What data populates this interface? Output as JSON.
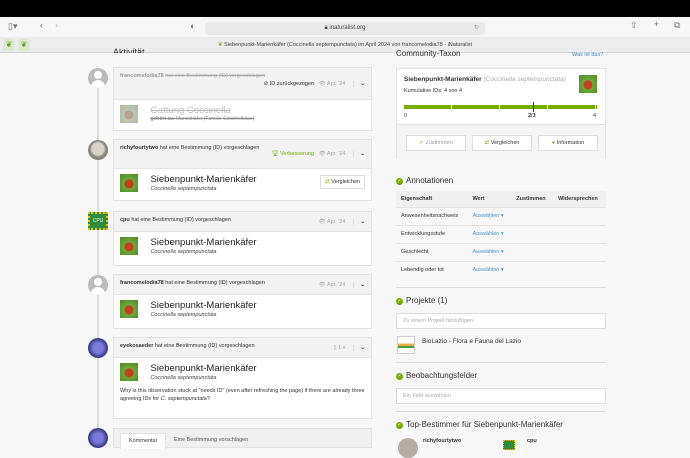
{
  "browser": {
    "url": "inaturalist.org",
    "tab_title": "Siebenpunkt-Marienkäfer (Coccinella septempunctata) im April 2024 von francomelodia78 · iNaturalist"
  },
  "activity": {
    "heading": "Aktivität",
    "items": [
      {
        "user": "francomelodia78",
        "action": "hat eine Bestimmung (ID) vorgeschlagen",
        "status": "ID zurückgezogen",
        "date": "Apr. '24",
        "taxon_common": "Gattung Coccinella",
        "belongs_label": "gehört zu:",
        "belongs": "Marienkäfer (Familie Coccinellidae)"
      },
      {
        "user": "richyfourtytwo",
        "action": "hat eine Bestimmung (ID) vorgeschlagen",
        "status": "Verbesserung",
        "date": "Apr. '24",
        "taxon_common": "Siebenpunkt-Marienkäfer",
        "taxon_sci": "Coccinella septempunctata",
        "compare": "Vergleichen"
      },
      {
        "user": "cpu",
        "action": "hat eine Bestimmung (ID) vorgeschlagen",
        "date": "Apr. '24",
        "taxon_common": "Siebenpunkt-Marienkäfer",
        "taxon_sci": "Coccinella septempunctata"
      },
      {
        "user": "francomelodia78",
        "action": "hat eine Bestimmung (ID) vorgeschlagen",
        "date": "Apr. '24",
        "taxon_common": "Siebenpunkt-Marienkäfer",
        "taxon_sci": "Coccinella septempunctata"
      },
      {
        "user": "eyekosaeder",
        "action": "hat eine Bestimmung (ID) vorgeschlagen",
        "date": "1 s",
        "taxon_common": "Siebenpunkt-Marienkäfer",
        "taxon_sci": "Coccinella septempunctata",
        "comment": "Why is this observation stuck at \"needs ID\" (even after refreshing the page) if there are already three agreeing IDs for",
        "comment_taxon": "C. septempunctata",
        "comment_end": "?"
      }
    ],
    "tabs": [
      "Kommentar",
      "Eine Bestimmung vorschlagen"
    ]
  },
  "community": {
    "title": "Community-Taxon",
    "help": "Was ist das?",
    "common": "Siebenpunkt-Marienkäfer",
    "sci": "(Coccinella septempunctata)",
    "cumulative": "Kumulative IDs: 4 von 4",
    "progress": 1.0,
    "scale_min": "0",
    "scale_mid": "2/3",
    "scale_max": "4",
    "agree": "Zustimmen",
    "compare": "Vergleichen",
    "info": "Information"
  },
  "annotations": {
    "title": "Annotationen",
    "headers": [
      "Eigenschaft",
      "Wert",
      "Zustimmen",
      "Widersprechen"
    ],
    "rows": [
      {
        "prop": "Anwesenheitsnachweis",
        "value": "Auswählen"
      },
      {
        "prop": "Entwicklungsstufe",
        "value": "Auswählen"
      },
      {
        "prop": "Geschlecht",
        "value": "Auswählen"
      },
      {
        "prop": "Lebendig oder tot",
        "value": "Auswählen"
      }
    ]
  },
  "projects": {
    "title": "Projekte (1)",
    "placeholder": "Zu einem Projekt hinzufügen",
    "items": [
      {
        "name": "BioLazio - Flora e Fauna del Lazio"
      }
    ]
  },
  "fields": {
    "title": "Beobachtungsfelder",
    "placeholder": "Ein Feld auswählen"
  },
  "top": {
    "title": "Top-Bestimmer für Siebenpunkt-Marienkäfer",
    "users": [
      "richyfourtytwo",
      "cpu"
    ]
  }
}
